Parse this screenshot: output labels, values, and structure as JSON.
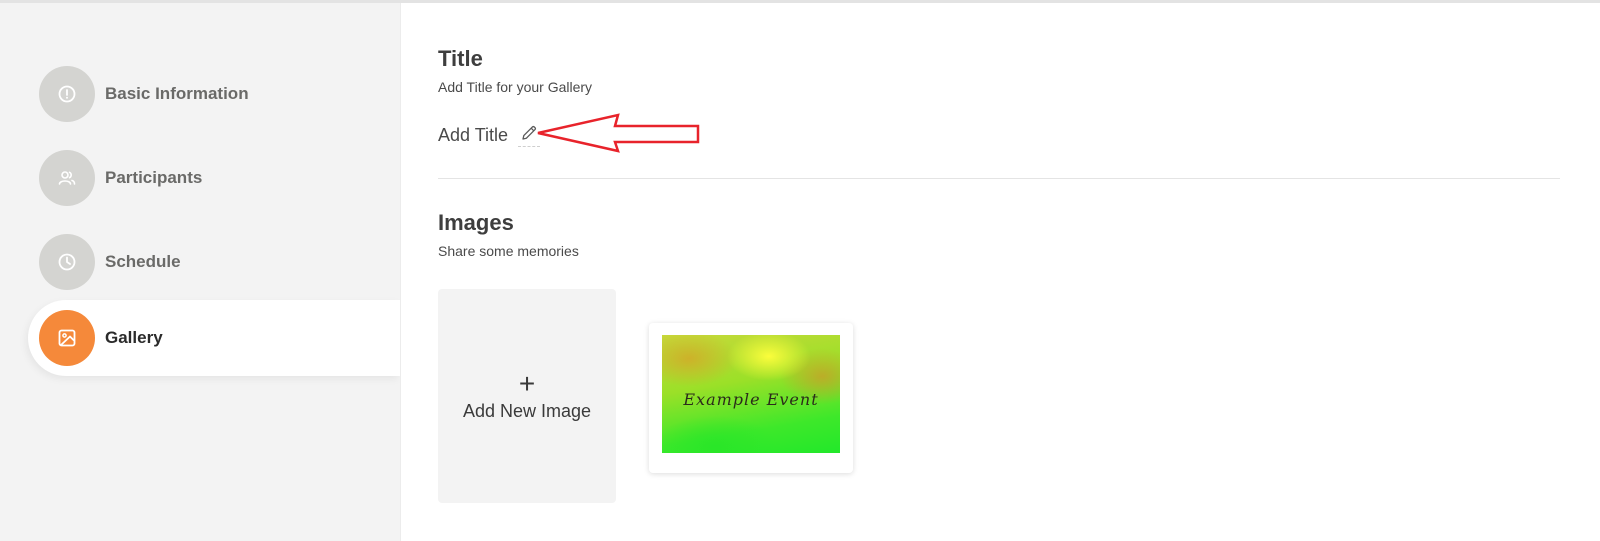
{
  "sidebar": {
    "items": [
      {
        "label": "Basic Information",
        "icon": "info-icon",
        "active": false
      },
      {
        "label": "Participants",
        "icon": "users-icon",
        "active": false
      },
      {
        "label": "Schedule",
        "icon": "clock-icon",
        "active": false
      },
      {
        "label": "Gallery",
        "icon": "image-icon",
        "active": true
      }
    ]
  },
  "title_section": {
    "heading": "Title",
    "subtitle": "Add Title for your Gallery",
    "add_title_label": "Add Title",
    "edit_icon": "pencil-icon"
  },
  "images_section": {
    "heading": "Images",
    "subtitle": "Share some memories",
    "add_button_plus": "+",
    "add_button_label": "Add New Image",
    "thumbnail_text": "Example Event"
  },
  "annotation": {
    "type": "red-arrow",
    "color": "#e8232b"
  },
  "colors": {
    "accent": "#f5893a",
    "sidebar_bg": "#f3f3f3",
    "inactive_circle": "#d4d4d1"
  }
}
